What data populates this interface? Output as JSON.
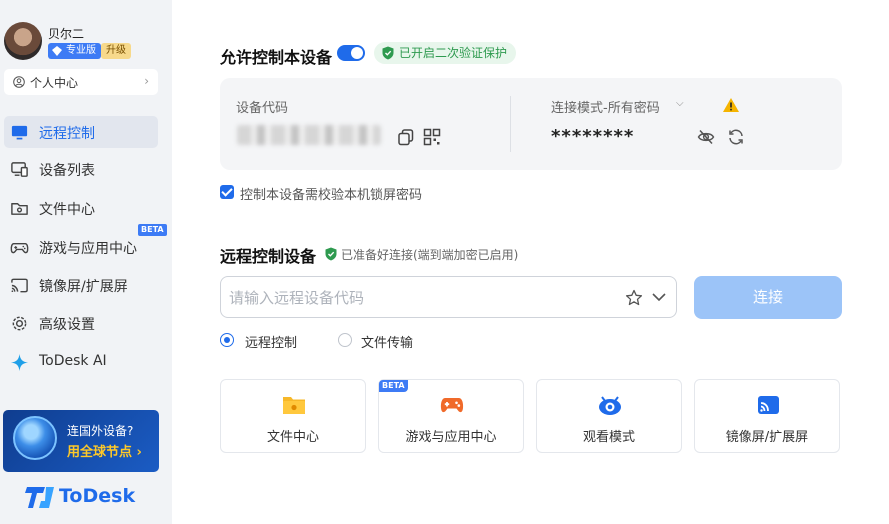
{
  "user": {
    "name": "贝尔二",
    "plan_badge": "专业版",
    "upgrade_label": "升级"
  },
  "sidebar": {
    "personal_center": "个人中心",
    "items": [
      {
        "label": "远程控制",
        "icon": "monitor-icon",
        "active": true
      },
      {
        "label": "设备列表",
        "icon": "devices-icon"
      },
      {
        "label": "文件中心",
        "icon": "folder-icon"
      },
      {
        "label": "游戏与应用中心",
        "icon": "gamepad-icon",
        "badge": "BETA"
      },
      {
        "label": "镜像屏/扩展屏",
        "icon": "cast-icon"
      },
      {
        "label": "高级设置",
        "icon": "gear-icon"
      },
      {
        "label": "ToDesk AI",
        "icon": "sparkle-icon"
      }
    ],
    "promo": {
      "question": "连国外设备?",
      "cta": "用全球节点"
    },
    "logo_text": "ToDesk"
  },
  "allow_control": {
    "title": "允许控制本设备",
    "enabled": true,
    "security_pill": "已开启二次验证保护",
    "device_code_label": "设备代码",
    "mode_label": "连接模式-所有密码",
    "password_mask": "********",
    "lock_screen_check": "控制本设备需校验本机锁屏密码"
  },
  "remote_control": {
    "title": "远程控制设备",
    "status": "已准备好连接(端到端加密已启用)",
    "input_placeholder": "请输入远程设备代码",
    "connect_label": "连接",
    "modes": [
      {
        "label": "远程控制",
        "selected": true
      },
      {
        "label": "文件传输",
        "selected": false
      }
    ],
    "tiles": [
      {
        "label": "文件中心",
        "icon": "folder-icon"
      },
      {
        "label": "游戏与应用中心",
        "icon": "gamepad-icon",
        "badge": "BETA"
      },
      {
        "label": "观看模式",
        "icon": "eye-icon"
      },
      {
        "label": "镜像屏/扩展屏",
        "icon": "cast-icon"
      }
    ]
  },
  "colors": {
    "accent": "#1f6bea",
    "connect_disabled": "#9cc4f8",
    "sidebar_bg": "#f1f3f6"
  }
}
